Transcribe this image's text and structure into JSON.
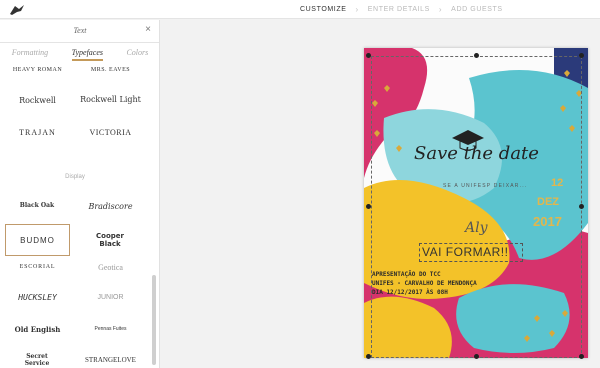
{
  "header": {
    "logo_icon": "bird-logo-icon",
    "steps": [
      {
        "label": "CUSTOMIZE",
        "active": true
      },
      {
        "label": "ENTER DETAILS",
        "active": false
      },
      {
        "label": "ADD GUESTS",
        "active": false
      }
    ],
    "separator": "›"
  },
  "panel": {
    "title": "Text",
    "close_icon": "close-icon",
    "close_glyph": "×",
    "tabs": [
      "Formatting",
      "Typefaces",
      "Colors"
    ],
    "active_tab": "Typefaces",
    "section_label": "Display",
    "fonts_top": [
      [
        "HEAVY ROMAN",
        "MRS. EAVES"
      ],
      [
        "Rockwell",
        "Rockwell Light"
      ],
      [
        "TRAJAN",
        "VICTORIA"
      ]
    ],
    "fonts_display": [
      [
        "Black Oak",
        "Bradiscore"
      ],
      [
        "BUDMO",
        "Cooper Black"
      ],
      [
        "ESCORIAL",
        "Geotica"
      ],
      [
        "HUCKSLEY",
        "JUNIOR"
      ],
      [
        "Old English",
        "Pennas Fuites"
      ],
      [
        "Secret Service",
        "STRANGELOVE"
      ]
    ],
    "selected_font": "BUDMO"
  },
  "card": {
    "title": "Save the date",
    "subtitle": "SE A UNIFESP DEIXAR...",
    "day": "12",
    "month": "DEZ",
    "year": "2017",
    "name": "Aly",
    "headline": "VAI FORMAR!!",
    "details": [
      "APRESENTAÇÃO DO TCC",
      "UNIFES - CARVALHO DE MENDONÇA",
      "DIA 12/12/2017 ÀS 08H"
    ],
    "graduation_cap_icon": "graduation-cap-icon",
    "heart_icon": "heart-icon",
    "colors": {
      "magenta": "#d6336c",
      "teal": "#5bc4cf",
      "yellow": "#f3c229",
      "navy": "#2b3a7a",
      "gold": "#d9a93a"
    }
  }
}
